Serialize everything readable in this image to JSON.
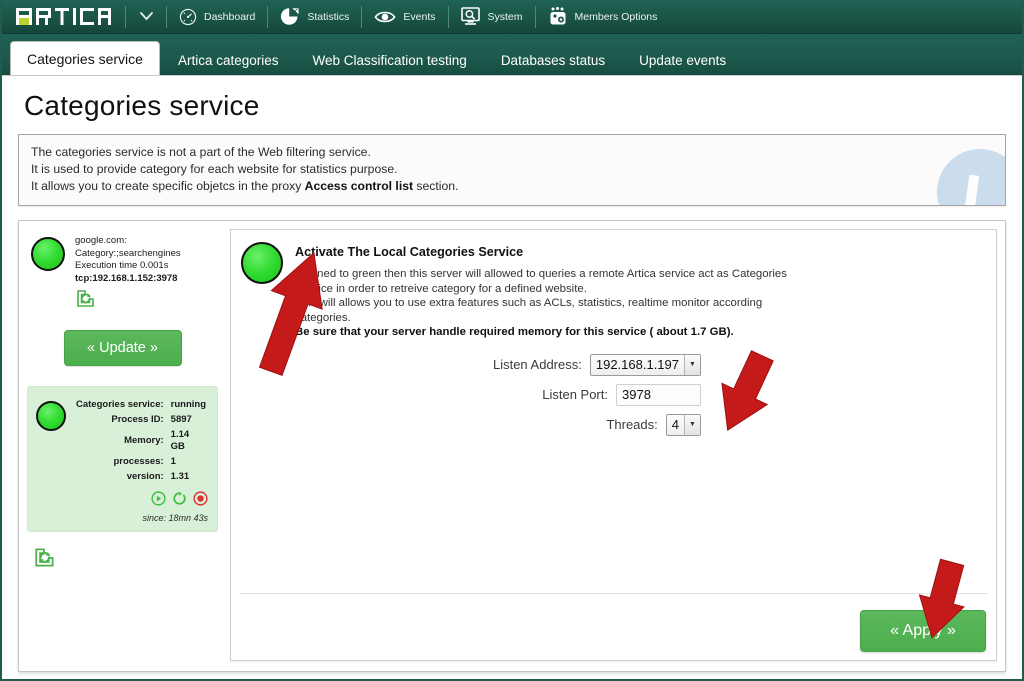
{
  "topbar": {
    "logo_text": "ARTICA",
    "logo_accent_letter": "A",
    "caret_icon": "chevron-down-icon",
    "items": [
      {
        "label": "Dashboard",
        "icon": "gauge-icon"
      },
      {
        "label": "Statistics",
        "icon": "pie-chart-icon"
      },
      {
        "label": "Events",
        "icon": "eye-icon"
      },
      {
        "label": "System",
        "icon": "monitor-search-icon"
      },
      {
        "label": "Members Options",
        "icon": "members-icon"
      }
    ]
  },
  "tabs": [
    {
      "label": "Categories service",
      "active": true
    },
    {
      "label": "Artica categories",
      "active": false
    },
    {
      "label": "Web Classification testing",
      "active": false
    },
    {
      "label": "Databases status",
      "active": false
    },
    {
      "label": "Update events",
      "active": false
    }
  ],
  "page": {
    "title": "Categories service"
  },
  "info_box": {
    "line1": "The categories service is not a part of the Web filtering service.",
    "line2": "It is used to provide category for each website for statistics purpose.",
    "line3_pre": "It allows you to create specific objetcs in the proxy ",
    "line3_bold": "Access control list",
    "line3_post": " section.",
    "watermark_icon": "info-circle-watermark"
  },
  "left_panel": {
    "lookup": {
      "status_icon": "green-status-dot",
      "domain": "google.com:",
      "category": "Category:;searchengines",
      "execution_time": "Execution time 0.001s",
      "endpoint": "tcp:192.168.1.152:3978",
      "refresh_icon": "refresh-sync-icon"
    },
    "update_button": "« Update »",
    "service_status": {
      "status_icon": "green-status-dot",
      "rows": [
        {
          "key": "Categories service:",
          "value": "running"
        },
        {
          "key": "Process ID:",
          "value": "5897"
        },
        {
          "key": "Memory:",
          "value": "1.14 GB"
        },
        {
          "key": "processes:",
          "value": "1"
        },
        {
          "key": "version:",
          "value": "1.31"
        }
      ],
      "actions": [
        {
          "icon": "start-service-icon",
          "color": "#3fbf3f"
        },
        {
          "icon": "restart-service-icon",
          "color": "#3fbf3f"
        },
        {
          "icon": "stop-service-icon",
          "color": "#e03030"
        }
      ],
      "since": "since: 18mn 43s"
    },
    "bottom_refresh_icon": "refresh-sync-icon"
  },
  "main_panel": {
    "toggle_icon": "green-status-dot",
    "title": "Activate The Local Categories Service",
    "desc_line1": "if turned to green then this server will allowed to queries a remote Artica service act as Categories",
    "desc_line2": "Service in order to retreive category for a defined website.",
    "desc_line3": "This will allows you to use extra features such as ACLs, statistics, realtime monitor according",
    "desc_line4": "categories.",
    "desc_line5_bold": "Be sure that your server handle required memory for this service ( about 1.7 GB).",
    "fields": {
      "listen_address_label": "Listen Address:",
      "listen_address_value": "192.168.1.197",
      "listen_port_label": "Listen Port:",
      "listen_port_value": "3978",
      "threads_label": "Threads:",
      "threads_value": "4"
    },
    "apply_button": "« Apply »"
  },
  "annotations": {
    "arrow_color": "#c41a1a",
    "arrows": [
      {
        "name": "arrow-to-activate-toggle"
      },
      {
        "name": "arrow-to-listen-address"
      },
      {
        "name": "arrow-to-apply-button"
      }
    ]
  },
  "colors": {
    "header_green": "#1a5547",
    "accent_green": "#5cb85c",
    "status_green": "#35dd35",
    "arrow_red": "#c41a1a",
    "tab_active_bg": "#ffffff"
  }
}
